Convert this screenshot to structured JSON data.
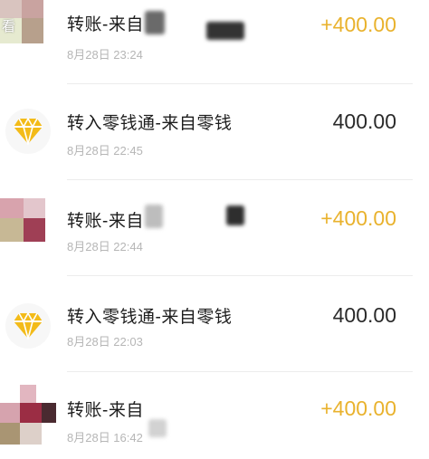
{
  "top_badge": "看",
  "colors": {
    "income": "#e9b22d",
    "plain": "#2a2a2a",
    "date": "#b6b6b6",
    "gem": "#f3bb19"
  },
  "transactions": [
    {
      "title": "转账-来自",
      "date": "8月28日 23:24",
      "amount": "+400.00",
      "type": "transfer",
      "icon": "blurred-avatar"
    },
    {
      "title": "转入零钱通-来自零钱",
      "date": "8月28日 22:45",
      "amount": "400.00",
      "type": "lingqiantong",
      "icon": "diamond-icon"
    },
    {
      "title": "转账-来自",
      "date": "8月28日 22:44",
      "amount": "+400.00",
      "type": "transfer",
      "icon": "blurred-avatar"
    },
    {
      "title": "转入零钱通-来自零钱",
      "date": "8月28日 22:03",
      "amount": "400.00",
      "type": "lingqiantong",
      "icon": "diamond-icon"
    },
    {
      "title": "转账-来自",
      "date": "8月28日 16:42",
      "amount": "+400.00",
      "type": "transfer",
      "icon": "blurred-avatar"
    }
  ]
}
